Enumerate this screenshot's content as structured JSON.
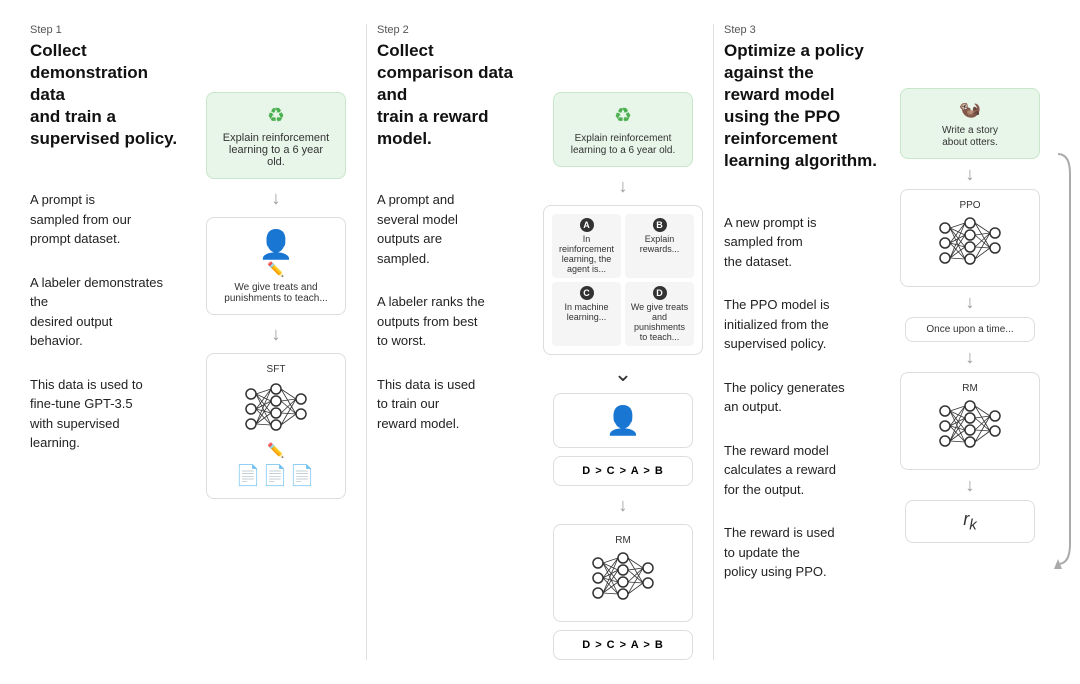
{
  "steps": [
    {
      "label": "Step 1",
      "title": "Collect demonstration data\nand train a supervised policy.",
      "descriptions": [
        "A prompt is\nsampled from our\nprompt dataset.",
        "A labeler demonstrates the\ndesired output\nbehavior.",
        "This data is used to\nfine-tune GPT-3.5\nwith supervised\nlearning."
      ],
      "prompt_text": "Explain reinforcement\nlearning to a 6 year old.",
      "white_box_text": "We give treats and\npunishments to teach...",
      "sft_label": "SFT"
    },
    {
      "label": "Step 2",
      "title": "Collect comparison data and\ntrain a reward model.",
      "descriptions": [
        "A prompt and\nseveral model\noutputs are\nsampled.",
        "A labeler ranks the\noutputs from best\nto worst.",
        "This data is used\nto train our\nreward model."
      ],
      "prompt_text": "Explain reinforcement\nlearning to a 6 year old.",
      "quadrant_items": [
        {
          "label": "A",
          "text": "In reinforcement\nlearning, the\nagent is..."
        },
        {
          "label": "B",
          "text": "Explain rewards..."
        },
        {
          "label": "C",
          "text": "In machine\nlearning..."
        },
        {
          "label": "D",
          "text": "We give treats and\npunishments to\nteach..."
        }
      ],
      "rank_text": "D > C > A > B",
      "rm_label": "RM",
      "rm_rank_text": "D > C > A > B"
    },
    {
      "label": "Step 3",
      "title": "Optimize a policy against the\nreward model using the PPO\nreinforcement learning algorithm.",
      "descriptions": [
        "A new prompt is\nsampled from\nthe dataset.",
        "The PPO model is\ninitialized from the\nsupervised policy.",
        "The policy generates\nan output.",
        "The reward model\ncalculates a reward\nfor the output.",
        "The reward is used\nto update the\npolicy using PPO."
      ],
      "prompt_text": "Write a story\nabout otters.",
      "ppo_label": "PPO",
      "output_text": "Once upon a time...",
      "rm_label": "RM",
      "rk_text": "rk"
    }
  ]
}
